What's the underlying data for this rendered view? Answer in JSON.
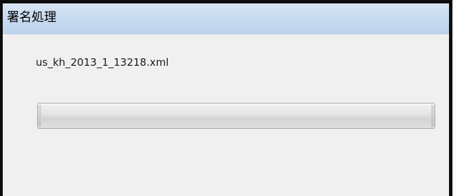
{
  "window": {
    "title": "署名処理"
  },
  "content": {
    "file_name": "us_kh_2013_1_13218.xml"
  },
  "progress": {
    "value_percent": 0
  },
  "colors": {
    "title_bar": "#c9dbf1",
    "background": "#f0f0f0",
    "frame": "#0d0d0d"
  }
}
